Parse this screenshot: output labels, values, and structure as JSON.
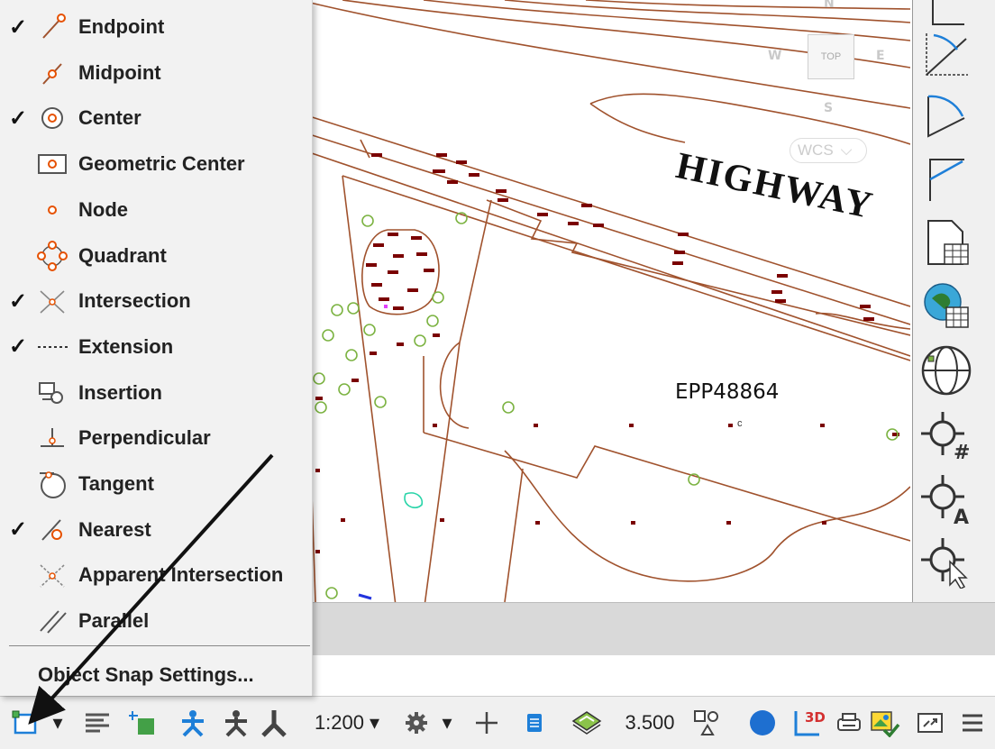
{
  "snap_menu": {
    "items": [
      {
        "label": "Endpoint",
        "checked": true,
        "icon": "endpoint-icon"
      },
      {
        "label": "Midpoint",
        "checked": false,
        "icon": "midpoint-icon"
      },
      {
        "label": "Center",
        "checked": true,
        "icon": "center-icon"
      },
      {
        "label": "Geometric Center",
        "checked": false,
        "icon": "geometric-center-icon"
      },
      {
        "label": "Node",
        "checked": false,
        "icon": "node-icon"
      },
      {
        "label": "Quadrant",
        "checked": false,
        "icon": "quadrant-icon"
      },
      {
        "label": "Intersection",
        "checked": true,
        "icon": "intersection-icon"
      },
      {
        "label": "Extension",
        "checked": true,
        "icon": "extension-icon"
      },
      {
        "label": "Insertion",
        "checked": false,
        "icon": "insertion-icon"
      },
      {
        "label": "Perpendicular",
        "checked": false,
        "icon": "perpendicular-icon"
      },
      {
        "label": "Tangent",
        "checked": false,
        "icon": "tangent-icon"
      },
      {
        "label": "Nearest",
        "checked": true,
        "icon": "nearest-icon"
      },
      {
        "label": "Apparent Intersection",
        "checked": false,
        "icon": "apparent-intersection-icon"
      },
      {
        "label": "Parallel",
        "checked": false,
        "icon": "parallel-icon"
      }
    ],
    "check_glyph": "✓",
    "settings_label": "Object Snap Settings..."
  },
  "drawing": {
    "highway_text": "HIGHWAY",
    "parcel_label": "EPP48864",
    "lot_marker": "c"
  },
  "viewcube": {
    "north": "N",
    "south": "S",
    "east": "E",
    "west": "W",
    "face": "TOP",
    "wcs": "WCS"
  },
  "status_bar": {
    "scale": "1:200",
    "lineweight": "3.500",
    "dropdown_glyph": "▾"
  },
  "colors": {
    "linework": "#a0522d",
    "tree": "#7cb342",
    "marker": "#7a0000",
    "accent_blue": "#1e7fd8",
    "menu_bg": "#f2f2f2"
  }
}
